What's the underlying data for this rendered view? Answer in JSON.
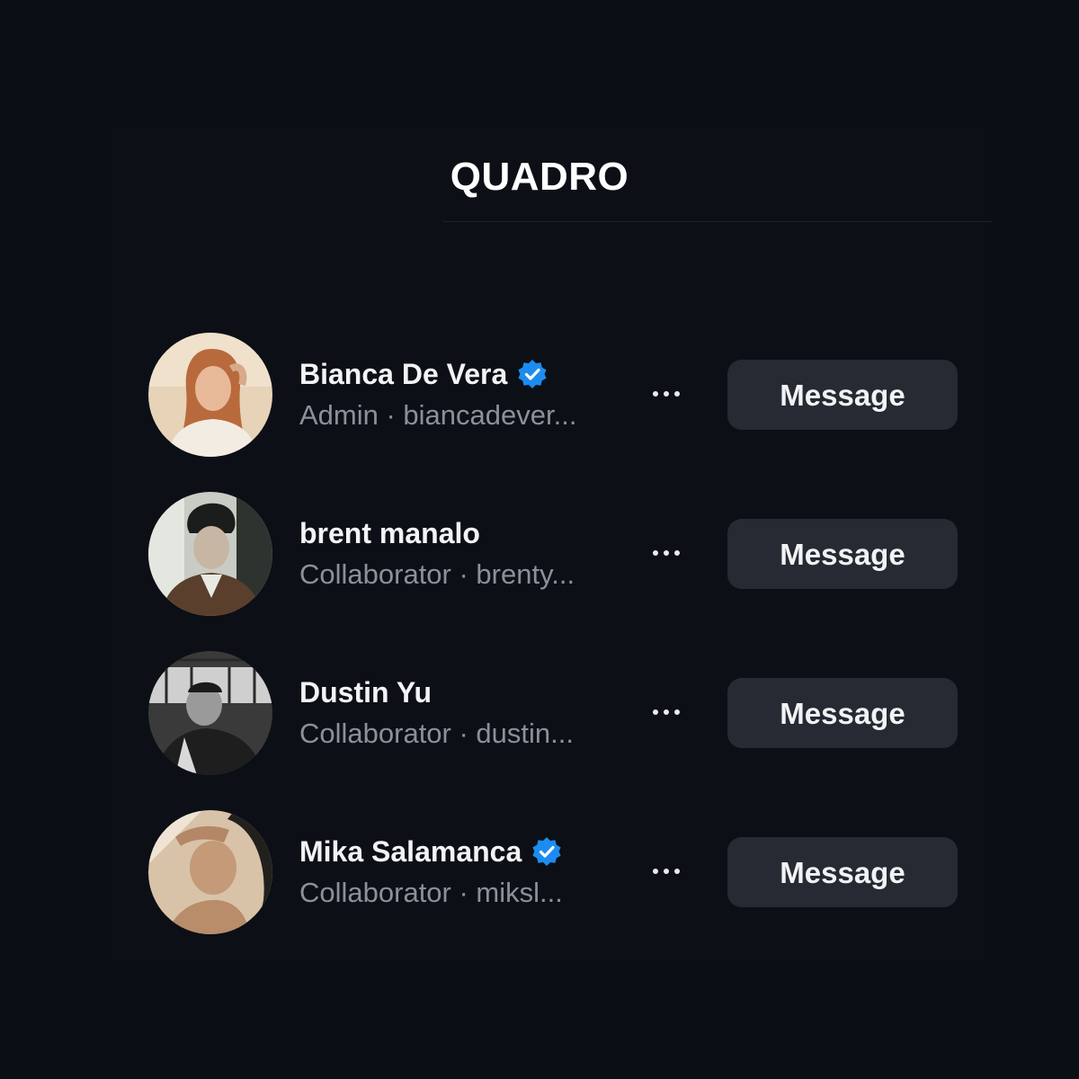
{
  "header": {
    "title": "QUADRO"
  },
  "theme": {
    "background": "#0b0e14",
    "button_bg": "#262a33",
    "verified_color": "#1d8cf0",
    "secondary_text": "#8b909b"
  },
  "members": [
    {
      "name": "Bianca De Vera",
      "verified": true,
      "subtitle": "Admin · biancadever...",
      "more_icon": "ellipsis-icon",
      "button_label": "Message",
      "avatar_palette": "warm-beige"
    },
    {
      "name": "brent manalo",
      "verified": false,
      "subtitle": "Collaborator · brenty...",
      "more_icon": "ellipsis-icon",
      "button_label": "Message",
      "avatar_palette": "muted-green-brown"
    },
    {
      "name": "Dustin Yu",
      "verified": false,
      "subtitle": "Collaborator · dustin...",
      "more_icon": "ellipsis-icon",
      "button_label": "Message",
      "avatar_palette": "black-and-white"
    },
    {
      "name": "Mika Salamanca",
      "verified": true,
      "subtitle": "Collaborator · miksl...",
      "more_icon": "ellipsis-icon",
      "button_label": "Message",
      "avatar_palette": "sepia-tan"
    }
  ]
}
